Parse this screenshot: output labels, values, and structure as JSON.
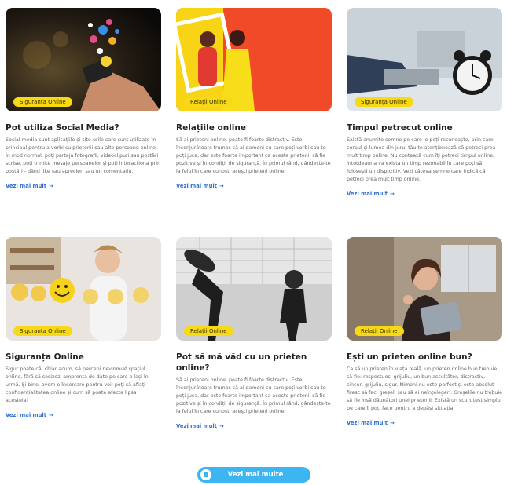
{
  "cards": [
    {
      "tag": "Siguranța Online",
      "title": "Pot utiliza Social Media?",
      "desc": "Social media sunt aplicațiile și site-urile care sunt utilizate în principal pentru a vorbi cu prietenii sau alte persoane online. În mod normal, poți partaja fotografii, videoclipuri sau postări scrise, poți trimite mesaje persoanelor și poți interacționa prin postări - dând like sau aprecieri sau un comentariu.",
      "more": "Vezi mai mult"
    },
    {
      "tag": "Relații Online",
      "title": "Relațiile online",
      "desc": "Să ai prieteni online, poate fi foarte distractiv. Este înconjurătoare frumos să ai oameni cu care poți vorbi sau te poți juca, dar este foarte important ca aceste prietenii să fie pozitive și în condiții de siguranță. În primul rând, gândește-te la felul în care cunoști acești prieteni online",
      "more": "Vezi mai mult"
    },
    {
      "tag": "Siguranța Online",
      "title": "Timpul petrecut online",
      "desc": "Există anumite semne pe care le poți recunoaște, prin care corpul și lumea din jurul tău te atenționează că petreci prea mult timp online. Nu contează cum îți petreci timpul online, întotdeauna va exista un timp rezonabil în care poți să folosești un dispozitiv. Vezi câteva semne care indică că petreci prea mult timp online.",
      "more": "Vezi mai mult"
    },
    {
      "tag": "Siguranța Online",
      "title": "Siguranța Online",
      "desc": "Sigur poate că, chiar acum, să percepi nevinovat spațiul online, fără să sesizezi amprenta de date pe care o lași în urmă. Și bine, avem o încercare pentru voi: poți să aflați confidențialitatea online și cum să poate afecta lipsa acesteia?",
      "more": "Vezi mai mult"
    },
    {
      "tag": "Relații Online",
      "title": "Pot să mă văd cu un prieten online?",
      "desc": "Să ai prieteni online, poate fi foarte distractiv. Este înconjurătoare frumos să ai oameni cu care poți vorbi sau te poți juca, dar este foarte important ca aceste prietenii să fie pozitive și în condiții de siguranță. În primul rând, gândește-te la felul în care cunoști acești prieteni online",
      "more": "Vezi mai mult"
    },
    {
      "tag": "Relații Online",
      "title": "Ești un prieten online bun?",
      "desc": "Ca să un prieten în viața reală, un prieten online bun trebuie să fie: respectuos, grijuliu, un bun ascultător, distractiv, sincer, grijuliu, sigur. Nimeni nu este perfect și este absolut firesc să faci greșeli sau să ai neînțelegeri. Greșelile nu trebuie să fie însă dăunători unei prietenii. Există un scurt test simplu pe care îl poți face pentru a depăși situația.",
      "more": "Vezi mai mult"
    }
  ],
  "load_more": "Vezi mai multe",
  "colors": {
    "tag_bg": "#f7d916",
    "link": "#2f6fd1",
    "button": "#3db5f0"
  }
}
